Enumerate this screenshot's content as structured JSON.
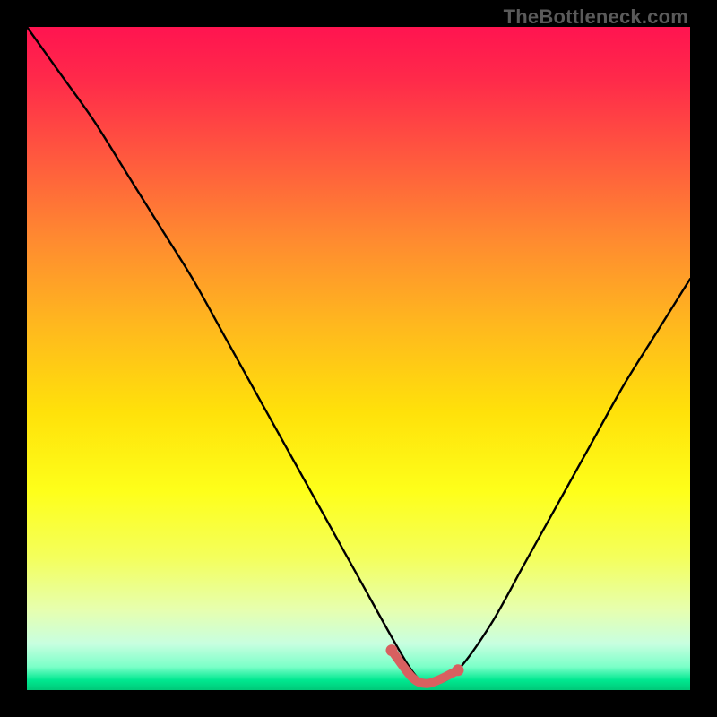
{
  "watermark": "TheBottleneck.com",
  "chart_data": {
    "type": "line",
    "title": "",
    "xlabel": "",
    "ylabel": "",
    "xlim": [
      0,
      100
    ],
    "ylim": [
      0,
      100
    ],
    "grid": false,
    "legend": false,
    "background": "rainbow-gradient-red-to-green",
    "series": [
      {
        "name": "bottleneck-curve",
        "x": [
          0,
          5,
          10,
          15,
          20,
          25,
          30,
          35,
          40,
          45,
          50,
          55,
          58,
          60,
          62,
          65,
          70,
          75,
          80,
          85,
          90,
          95,
          100
        ],
        "y": [
          100,
          93,
          86,
          78,
          70,
          62,
          53,
          44,
          35,
          26,
          17,
          8,
          3,
          1,
          1,
          3,
          10,
          19,
          28,
          37,
          46,
          54,
          62
        ]
      }
    ],
    "highlight": {
      "name": "optimal-range",
      "x": [
        55,
        58,
        60,
        62,
        65
      ],
      "y": [
        6,
        2,
        1,
        1.5,
        3
      ],
      "color": "#d86060"
    },
    "annotations": []
  }
}
